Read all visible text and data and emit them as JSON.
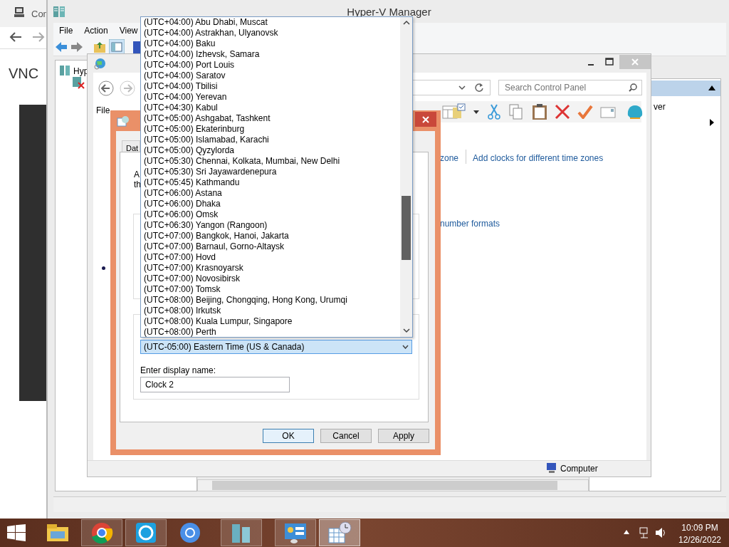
{
  "browser": {
    "tab_title": "Con",
    "heading": "VNC"
  },
  "hyperv": {
    "title": "Hyper-V Manager",
    "menu": [
      "File",
      "Action",
      "View"
    ],
    "tree": [
      "Hyp"
    ],
    "actions": {
      "item": "ver"
    }
  },
  "control_panel": {
    "menu": [
      "File"
    ],
    "search": {
      "placeholder": "Search Control Panel"
    },
    "links": [
      "zone",
      "Add clocks for different time zones",
      "number formats"
    ],
    "status": "Computer"
  },
  "dialog": {
    "tab": "Dat",
    "intro": [
      "A",
      "th"
    ],
    "timezone": "(UTC-05:00) Eastern Time (US & Canada)",
    "display_label": "Enter display name:",
    "display_name": "Clock 2",
    "buttons": [
      {
        "label": "OK",
        "default": true
      },
      {
        "label": "Cancel",
        "default": false
      },
      {
        "label": "Apply",
        "default": false
      }
    ],
    "dropdown": {
      "options": [
        "(UTC+04:00) Abu Dhabi, Muscat",
        "(UTC+04:00) Astrakhan, Ulyanovsk",
        "(UTC+04:00) Baku",
        "(UTC+04:00) Izhevsk, Samara",
        "(UTC+04:00) Port Louis",
        "(UTC+04:00) Saratov",
        "(UTC+04:00) Tbilisi",
        "(UTC+04:00) Yerevan",
        "(UTC+04:30) Kabul",
        "(UTC+05:00) Ashgabat, Tashkent",
        "(UTC+05:00) Ekaterinburg",
        "(UTC+05:00) Islamabad, Karachi",
        "(UTC+05:00) Qyzylorda",
        "(UTC+05:30) Chennai, Kolkata, Mumbai, New Delhi",
        "(UTC+05:30) Sri Jayawardenepura",
        "(UTC+05:45) Kathmandu",
        "(UTC+06:00) Astana",
        "(UTC+06:00) Dhaka",
        "(UTC+06:00) Omsk",
        "(UTC+06:30) Yangon (Rangoon)",
        "(UTC+07:00) Bangkok, Hanoi, Jakarta",
        "(UTC+07:00) Barnaul, Gorno-Altaysk",
        "(UTC+07:00) Hovd",
        "(UTC+07:00) Krasnoyarsk",
        "(UTC+07:00) Novosibirsk",
        "(UTC+07:00) Tomsk",
        "(UTC+08:00) Beijing, Chongqing, Hong Kong, Urumqi",
        "(UTC+08:00) Irkutsk",
        "(UTC+08:00) Kuala Lumpur, Singapore",
        "(UTC+08:00) Perth"
      ]
    }
  },
  "taskbar": {
    "apps": [
      {
        "kind": "explorer",
        "running": false,
        "selected": false
      },
      {
        "kind": "chrome",
        "running": true,
        "selected": false
      },
      {
        "kind": "skype",
        "running": true,
        "selected": false
      },
      {
        "kind": "chromium",
        "running": false,
        "selected": false
      },
      {
        "kind": "hyperv",
        "running": true,
        "selected": false
      },
      {
        "kind": "controlpanel",
        "running": true,
        "selected": false
      },
      {
        "kind": "clock",
        "running": true,
        "selected": true
      }
    ],
    "time": "10:09 PM",
    "date": "12/26/2022"
  }
}
